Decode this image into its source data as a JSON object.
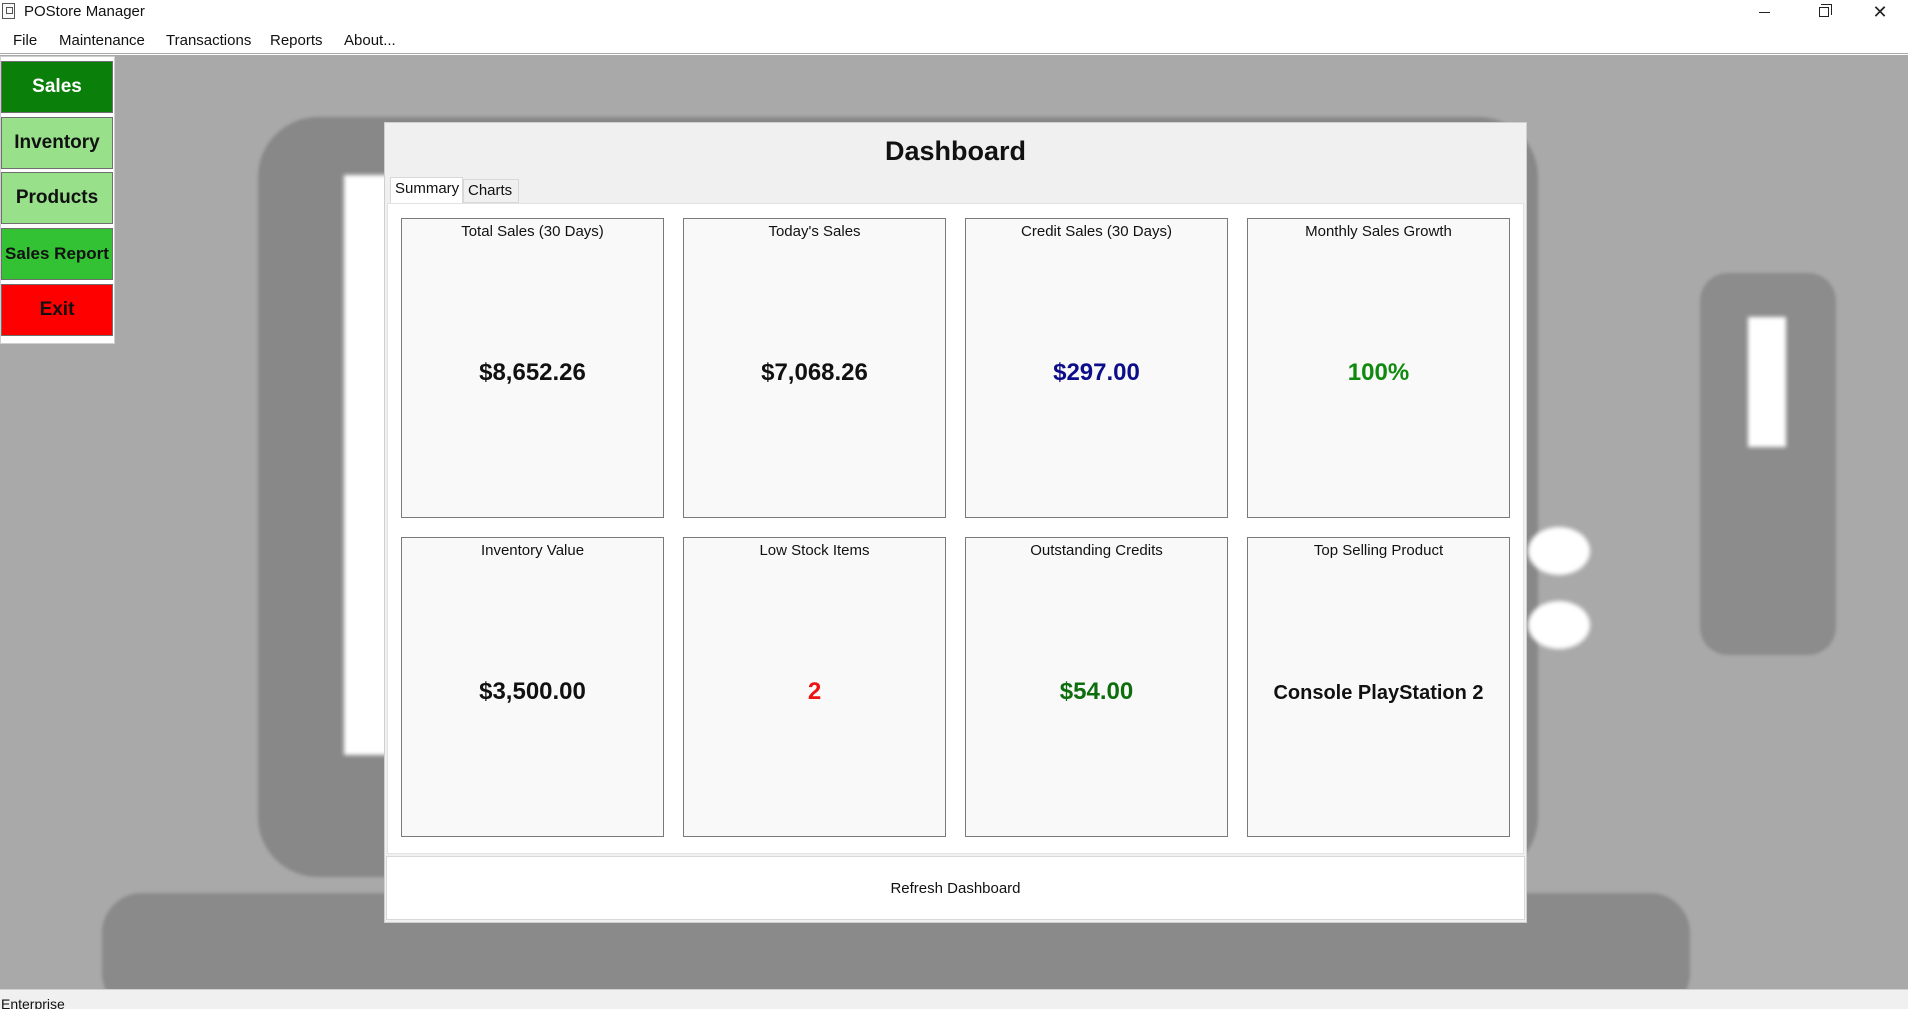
{
  "window": {
    "title": "POStore Manager",
    "icon": "app-icon",
    "controls": {
      "minimize": "minimize-icon",
      "maximize": "restore-icon",
      "close": "close-icon"
    }
  },
  "menu": {
    "items": [
      "File",
      "Maintenance",
      "Transactions",
      "Reports",
      "About..."
    ]
  },
  "sidebar": {
    "buttons": [
      {
        "label": "Sales",
        "color": "#0a7f0a"
      },
      {
        "label": "Inventory",
        "color": "#98e08a"
      },
      {
        "label": "Products",
        "color": "#98e08a"
      },
      {
        "label": "Sales Report",
        "color": "#33c233"
      },
      {
        "label": "Exit",
        "color": "#ff0000"
      }
    ]
  },
  "dashboard": {
    "title": "Dashboard",
    "tabs": [
      "Summary",
      "Charts"
    ],
    "active_tab": "Summary",
    "cards": [
      {
        "label": "Total Sales (30 Days)",
        "value": "$8,652.26",
        "color": "#111111"
      },
      {
        "label": "Today's Sales",
        "value": "$7,068.26",
        "color": "#111111"
      },
      {
        "label": "Credit Sales (30 Days)",
        "value": "$297.00",
        "color": "#0d0d8a"
      },
      {
        "label": "Monthly Sales Growth",
        "value": "100%",
        "color": "#0f8a0f"
      },
      {
        "label": "Inventory Value",
        "value": "$3,500.00",
        "color": "#111111"
      },
      {
        "label": "Low Stock Items",
        "value": "2",
        "color": "#ee1111"
      },
      {
        "label": "Outstanding Credits",
        "value": "$54.00",
        "color": "#0d6e0d"
      },
      {
        "label": "Top Selling Product",
        "value": "Console PlayStation 2",
        "color": "#111111"
      }
    ],
    "refresh_label": "Refresh Dashboard"
  },
  "statusbar": {
    "text": "Enterprise"
  }
}
